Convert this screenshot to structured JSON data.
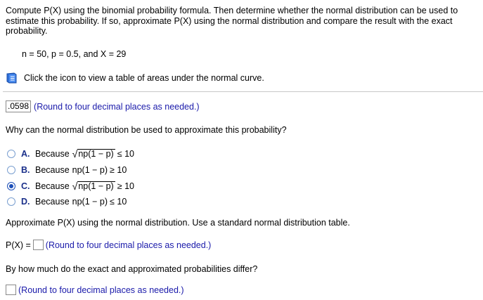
{
  "prompt": "Compute P(X) using the binomial probability formula. Then determine whether the normal distribution can be used to estimate this probability. If so, approximate P(X) using the normal distribution and compare the result with the exact probability.",
  "given": "n = 50, p = 0.5, and X = 29",
  "table_link": "Click the icon to view a table of areas under the normal curve.",
  "answer1": {
    "value": ".0598",
    "hint": "(Round to four decimal places as needed.)"
  },
  "question1": "Why can the normal distribution be used to approximate this probability?",
  "options": [
    {
      "letter": "A.",
      "prefix": "Because",
      "expr": "np(1 − p)",
      "rel": "≤ 10",
      "sqrt": true,
      "selected": false
    },
    {
      "letter": "B.",
      "prefix": "Because",
      "expr": "np(1 − p)",
      "rel": "≥ 10",
      "sqrt": false,
      "selected": false
    },
    {
      "letter": "C.",
      "prefix": "Because",
      "expr": "np(1 − p)",
      "rel": "≥ 10",
      "sqrt": true,
      "selected": true
    },
    {
      "letter": "D.",
      "prefix": "Because",
      "expr": "np(1 − p)",
      "rel": "≤ 10",
      "sqrt": false,
      "selected": false
    }
  ],
  "question2": "Approximate P(X) using the normal distribution. Use a standard normal distribution table.",
  "px_label": "P(X) =",
  "px_hint": "(Round to four decimal places as needed.)",
  "question3": "By how much do the exact and approximated probabilities differ?",
  "diff_hint": "(Round to four decimal places as needed.)"
}
